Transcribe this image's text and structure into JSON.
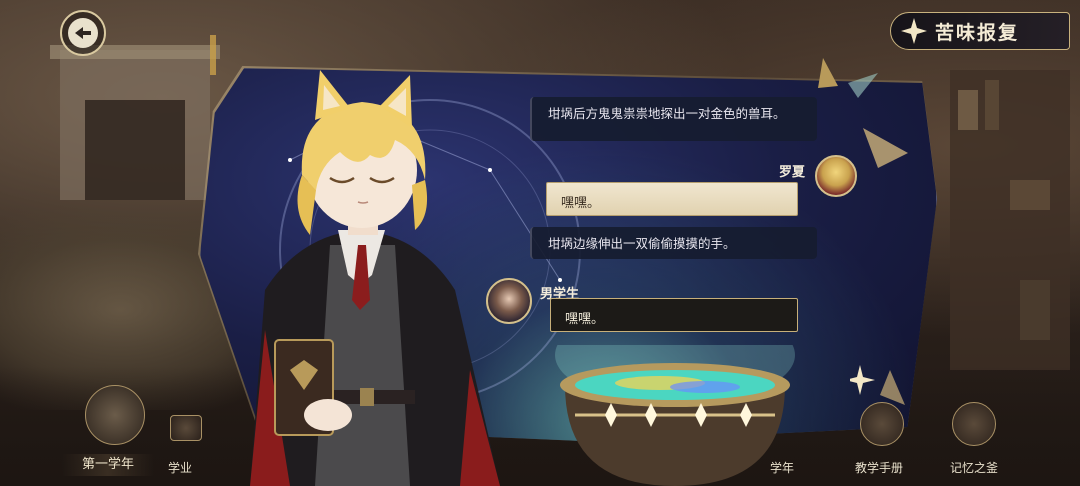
{
  "header": {
    "title": "苦味报复"
  },
  "dialogue": {
    "narration_1": "坩埚后方鬼鬼祟祟地探出一对金色的兽耳。",
    "speaker_1": "罗夏",
    "line_1": "嘿嘿。",
    "narration_2": "坩埚边缘伸出一双偷偷摸摸的手。",
    "speaker_2": "男学生",
    "line_2": "嘿嘿。"
  },
  "bottom_menu": {
    "year_tab": "第一学年",
    "academics": "学业",
    "year_course": "学年",
    "handbook": "教学手册",
    "memory": "记忆之釜"
  },
  "colors": {
    "accent_gold": "#c8b27e",
    "panel_navy": "#1a1e45",
    "glow_cyan": "#78dcc8"
  },
  "icons": {
    "back": "back-arrow-icon",
    "title": "four-point-star-icon"
  }
}
